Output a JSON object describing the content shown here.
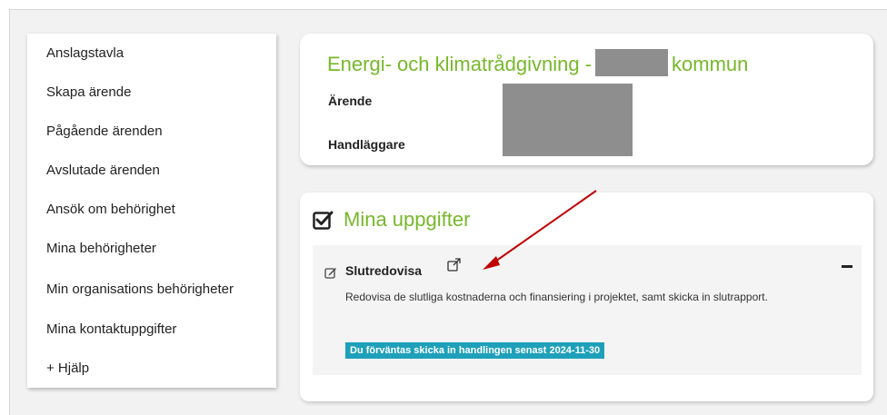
{
  "sidebar": {
    "items": [
      {
        "label": "Anslagstavla"
      },
      {
        "label": "Skapa ärende"
      },
      {
        "label": "Pågående ärenden"
      },
      {
        "label": "Avslutade ärenden"
      },
      {
        "label": "Ansök om behörighet"
      },
      {
        "label": "Mina behörigheter"
      },
      {
        "label": "Min organisations behörigheter"
      },
      {
        "label": "Mina kontaktuppgifter"
      },
      {
        "label": "+ Hjälp"
      }
    ]
  },
  "header": {
    "title_prefix": "Energi- och klimatrådgivning -",
    "title_suffix": "kommun",
    "field_case": "Ärende",
    "field_handler": "Handläggare"
  },
  "tasks": {
    "heading": "Mina uppgifter",
    "item": {
      "title": "Slutredovisa",
      "description": "Redovisa de slutliga kostnaderna och finansiering i projektet, samt skicka in slutrapport.",
      "due": "Du förväntas skicka in handlingen senast 2024-11-30"
    }
  },
  "colors": {
    "accent_green": "#76b82a",
    "badge_teal": "#1fa0ba",
    "arrow_red": "#c00000",
    "redaction_gray": "#8e8e8e"
  }
}
